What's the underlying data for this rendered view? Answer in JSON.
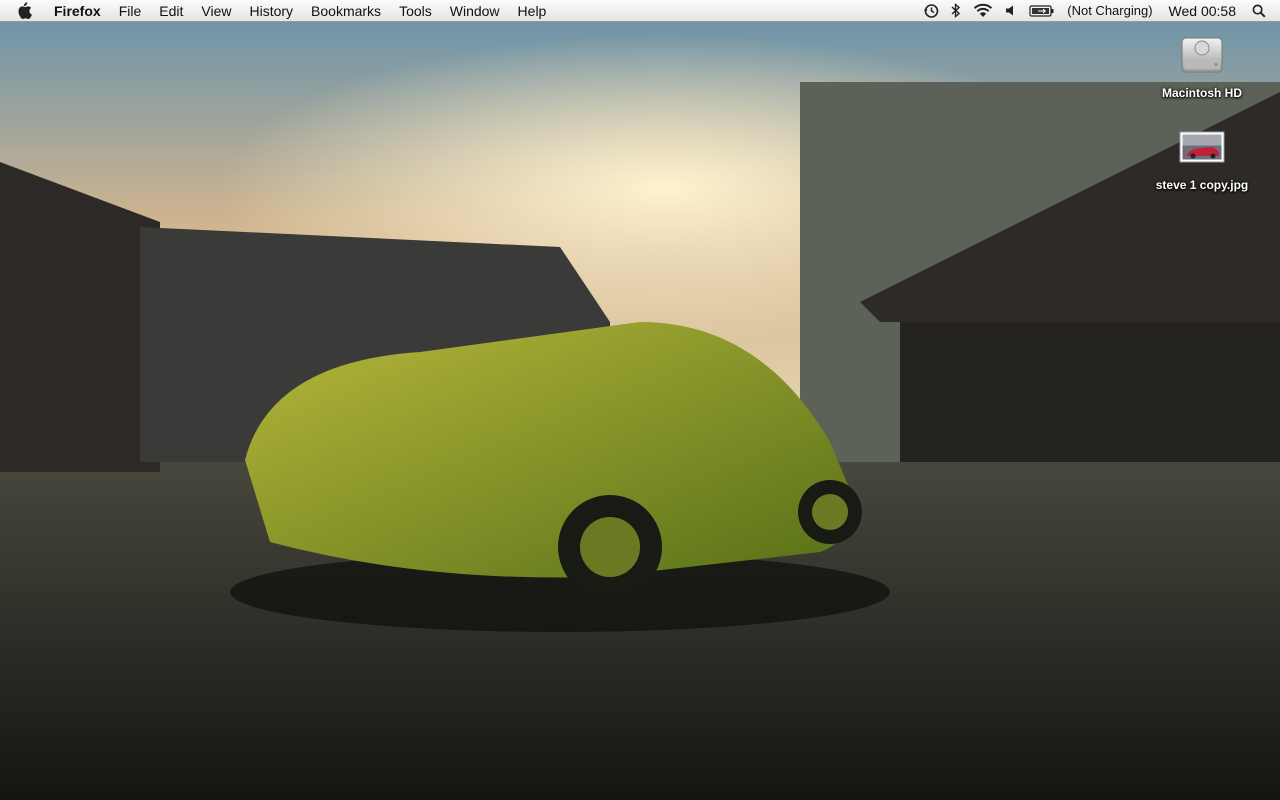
{
  "menubar": {
    "apple_icon": "apple-logo-icon",
    "app_name": "Firefox",
    "menus": [
      "File",
      "Edit",
      "View",
      "History",
      "Bookmarks",
      "Tools",
      "Window",
      "Help"
    ],
    "status_icons": [
      "time-machine-icon",
      "bluetooth-icon",
      "wifi-icon",
      "volume-icon",
      "battery-icon"
    ],
    "battery_status": "(Not Charging)",
    "clock": "Wed 00:58",
    "spotlight_icon": "spotlight-search-icon"
  },
  "desktop": {
    "icons": [
      {
        "label": "Macintosh HD",
        "icon": "hard-drive-icon"
      },
      {
        "label": "steve 1 copy.jpg",
        "icon": "image-file-thumbnail-icon"
      }
    ],
    "colors": {
      "sky_top": "#6f95a9",
      "sky_glow": "#fff2cf",
      "pavement": "#2a2d27",
      "car_body": "#8ea22a",
      "menubar_bg": "#efefef"
    }
  }
}
